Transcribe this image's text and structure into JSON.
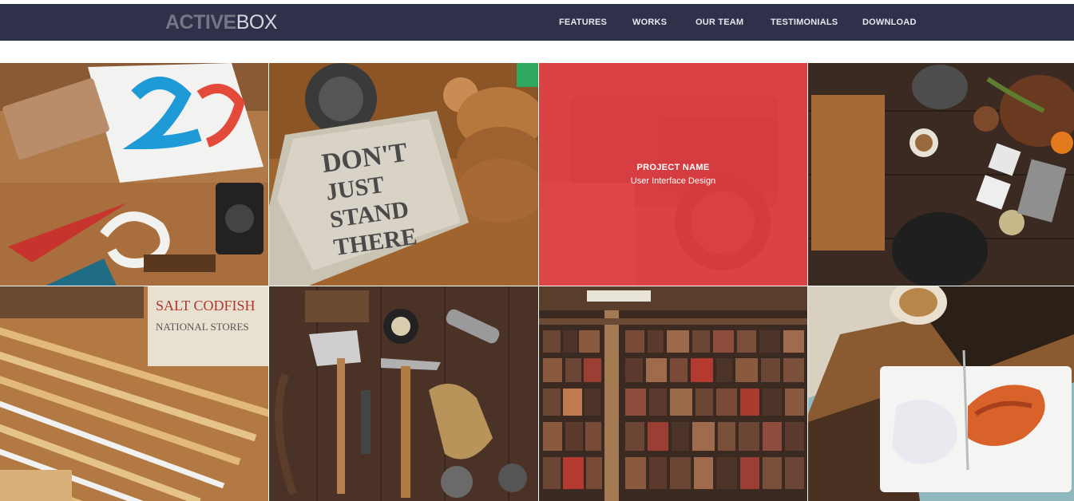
{
  "brand": {
    "bold": "ACTIVE",
    "light": "BOX"
  },
  "nav": [
    "FEATURES",
    "WORKS",
    "OUR TEAM",
    "TESTIMONIALS",
    "DOWNLOAD"
  ],
  "colors": {
    "navbar": "#2e3149",
    "overlay": "#e83e42"
  },
  "portfolio": [
    {
      "image": "school-supplies-flatlay"
    },
    {
      "image": "notebook-dont-just-stand-there"
    },
    {
      "image": "vintage-camera",
      "project_name": "PROJECT NAME",
      "category": "User Interface Design"
    },
    {
      "image": "kitchen-utensils-table"
    },
    {
      "image": "folding-rulers"
    },
    {
      "image": "tools-hatchet-hammer-gloves"
    },
    {
      "image": "letterpress-type-blocks"
    },
    {
      "image": "food-plate-wooden-table"
    }
  ]
}
